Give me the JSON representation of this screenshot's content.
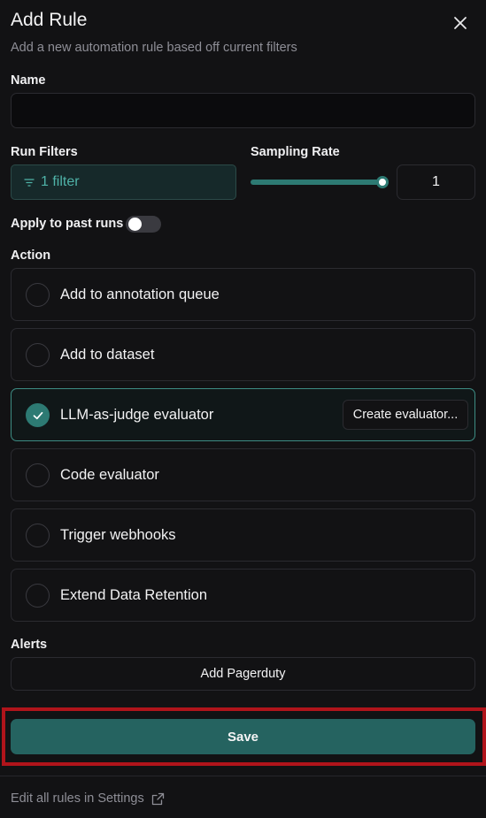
{
  "header": {
    "title": "Add Rule",
    "subtitle": "Add a new automation rule based off current filters"
  },
  "name_field": {
    "label": "Name",
    "value": ""
  },
  "run_filters": {
    "label": "Run Filters",
    "button_label": "1 filter"
  },
  "sampling": {
    "label": "Sampling Rate",
    "value": "1",
    "slider_value": 1.0
  },
  "past_runs": {
    "label": "Apply to past runs",
    "enabled": false
  },
  "action": {
    "label": "Action",
    "options": [
      {
        "label": "Add to annotation queue",
        "selected": false
      },
      {
        "label": "Add to dataset",
        "selected": false
      },
      {
        "label": "LLM-as-judge evaluator",
        "selected": true,
        "button": "Create evaluator..."
      },
      {
        "label": "Code evaluator",
        "selected": false
      },
      {
        "label": "Trigger webhooks",
        "selected": false
      },
      {
        "label": "Extend Data Retention",
        "selected": false
      }
    ]
  },
  "alerts": {
    "label": "Alerts",
    "button_label": "Add Pagerduty"
  },
  "footer": {
    "save_label": "Save",
    "settings_link": "Edit all rules in Settings"
  },
  "colors": {
    "accent": "#2d7a73",
    "save": "#256360",
    "highlight": "#b0141b",
    "background": "#121214"
  },
  "icons": {
    "close": "close-icon",
    "filter": "filter-icon",
    "check": "check-icon",
    "external": "external-link-icon"
  }
}
